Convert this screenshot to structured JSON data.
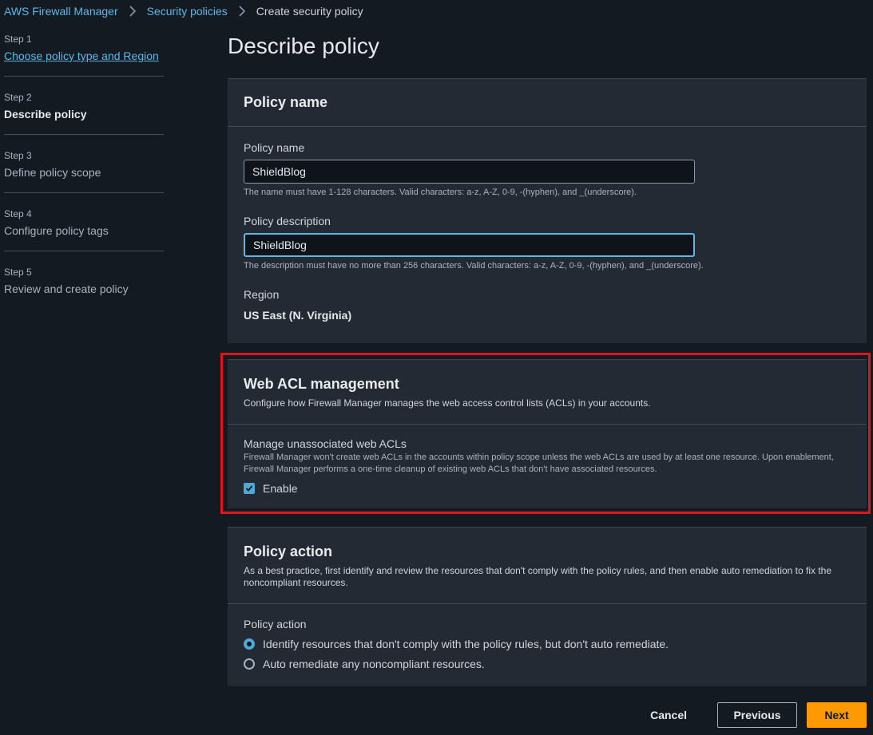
{
  "breadcrumb": {
    "items": [
      "AWS Firewall Manager",
      "Security policies"
    ],
    "current": "Create security policy"
  },
  "steps": [
    {
      "num": "Step 1",
      "label": "Choose policy type and Region"
    },
    {
      "num": "Step 2",
      "label": "Describe policy"
    },
    {
      "num": "Step 3",
      "label": "Define policy scope"
    },
    {
      "num": "Step 4",
      "label": "Configure policy tags"
    },
    {
      "num": "Step 5",
      "label": "Review and create policy"
    }
  ],
  "page_title": "Describe policy",
  "policy_name_panel": {
    "title": "Policy name",
    "name_label": "Policy name",
    "name_value": "ShieldBlog",
    "name_hint": "The name must have 1-128 characters. Valid characters: a-z, A-Z, 0-9, -(hyphen), and _(underscore).",
    "desc_label": "Policy description",
    "desc_value": "ShieldBlog",
    "desc_hint": "The description must have no more than 256 characters. Valid characters: a-z, A-Z, 0-9, -(hyphen), and _(underscore).",
    "region_label": "Region",
    "region_value": "US East (N. Virginia)"
  },
  "webacl_panel": {
    "title": "Web ACL management",
    "desc": "Configure how Firewall Manager manages the web access control lists (ACLs) in your accounts.",
    "sub_title": "Manage unassociated web ACLs",
    "sub_desc": "Firewall Manager won't create web ACLs in the accounts within policy scope unless the web ACLs are used by at least one resource. Upon enablement, Firewall Manager performs a one-time cleanup of existing web ACLs that don't have associated resources.",
    "checkbox_label": "Enable",
    "checked": true
  },
  "policy_action_panel": {
    "title": "Policy action",
    "desc": "As a best practice, first identify and review the resources that don't comply with the policy rules, and then enable auto remediation to fix the noncompliant resources.",
    "group_label": "Policy action",
    "options": [
      "Identify resources that don't comply with the policy rules, but don't auto remediate.",
      "Auto remediate any noncompliant resources."
    ],
    "selected_index": 0
  },
  "footer": {
    "cancel": "Cancel",
    "previous": "Previous",
    "next": "Next"
  },
  "colors": {
    "accent": "#5eb8e6",
    "primary_button": "#ff9900",
    "highlight": "#e0141c"
  }
}
